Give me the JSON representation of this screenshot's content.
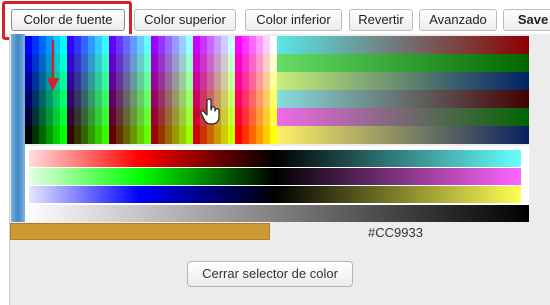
{
  "toolbar": {
    "buttons": [
      {
        "label": "Color de fuente"
      },
      {
        "label": "Color superior"
      },
      {
        "label": "Color inferior"
      },
      {
        "label": "Revertir"
      },
      {
        "label": "Avanzado"
      },
      {
        "label": "Save"
      }
    ],
    "active_button": "Color de fuente",
    "highlight_color": "#d6202a"
  },
  "color_picker": {
    "selected_hex": "#CC9933",
    "close_label": "Cerrar selector de color",
    "bar_color": "#3e86c6"
  },
  "annotation": {
    "arrow_icon": "down-arrow-icon",
    "cursor_icon": "hand-cursor-icon"
  }
}
